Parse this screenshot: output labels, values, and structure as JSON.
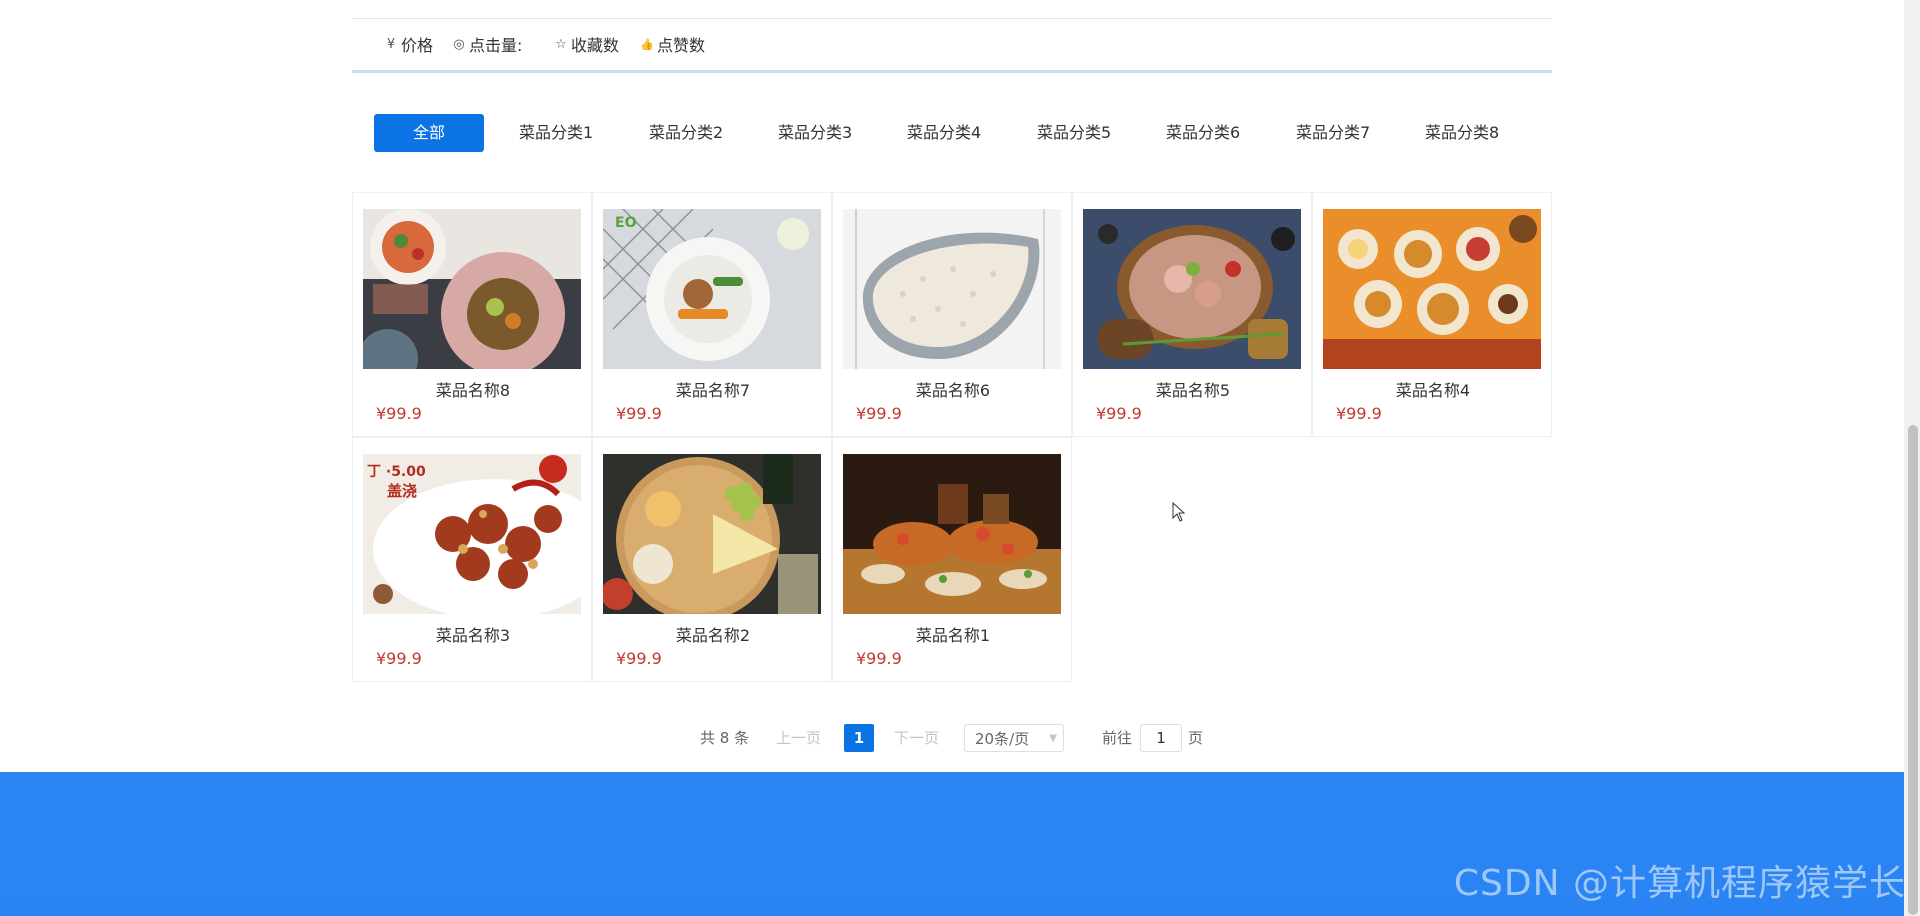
{
  "sort_bar": {
    "items": [
      {
        "icon": "yen-icon",
        "glyph": "¥",
        "label": "价格"
      },
      {
        "icon": "eye-icon",
        "glyph": "◎",
        "label": "点击量:"
      },
      {
        "icon": "star-icon",
        "glyph": "☆",
        "label": "收藏数"
      },
      {
        "icon": "thumb-up-icon",
        "glyph": "👍",
        "label": "点赞数"
      }
    ]
  },
  "tabs": [
    {
      "label": "全部",
      "active": true
    },
    {
      "label": "菜品分类1"
    },
    {
      "label": "菜品分类2"
    },
    {
      "label": "菜品分类3"
    },
    {
      "label": "菜品分类4"
    },
    {
      "label": "菜品分类5"
    },
    {
      "label": "菜品分类6"
    },
    {
      "label": "菜品分类7"
    },
    {
      "label": "菜品分类8"
    }
  ],
  "products": [
    {
      "name": "菜品名称8",
      "price": "¥99.9"
    },
    {
      "name": "菜品名称7",
      "price": "¥99.9"
    },
    {
      "name": "菜品名称6",
      "price": "¥99.9"
    },
    {
      "name": "菜品名称5",
      "price": "¥99.9"
    },
    {
      "name": "菜品名称4",
      "price": "¥99.9"
    },
    {
      "name": "菜品名称3",
      "price": "¥99.9"
    },
    {
      "name": "菜品名称2",
      "price": "¥99.9"
    },
    {
      "name": "菜品名称1",
      "price": "¥99.9"
    }
  ],
  "pagination": {
    "total": "共 8 条",
    "prev": "上一页",
    "current": "1",
    "next": "下一页",
    "page_size": "20条/页",
    "goto_prefix": "前往",
    "goto_value": "1",
    "goto_suffix": "页"
  },
  "watermark": "CSDN @计算机程序猿学长",
  "colors": {
    "accent": "#0b73e3",
    "price": "#c0392b",
    "footer": "#2b86f5"
  }
}
